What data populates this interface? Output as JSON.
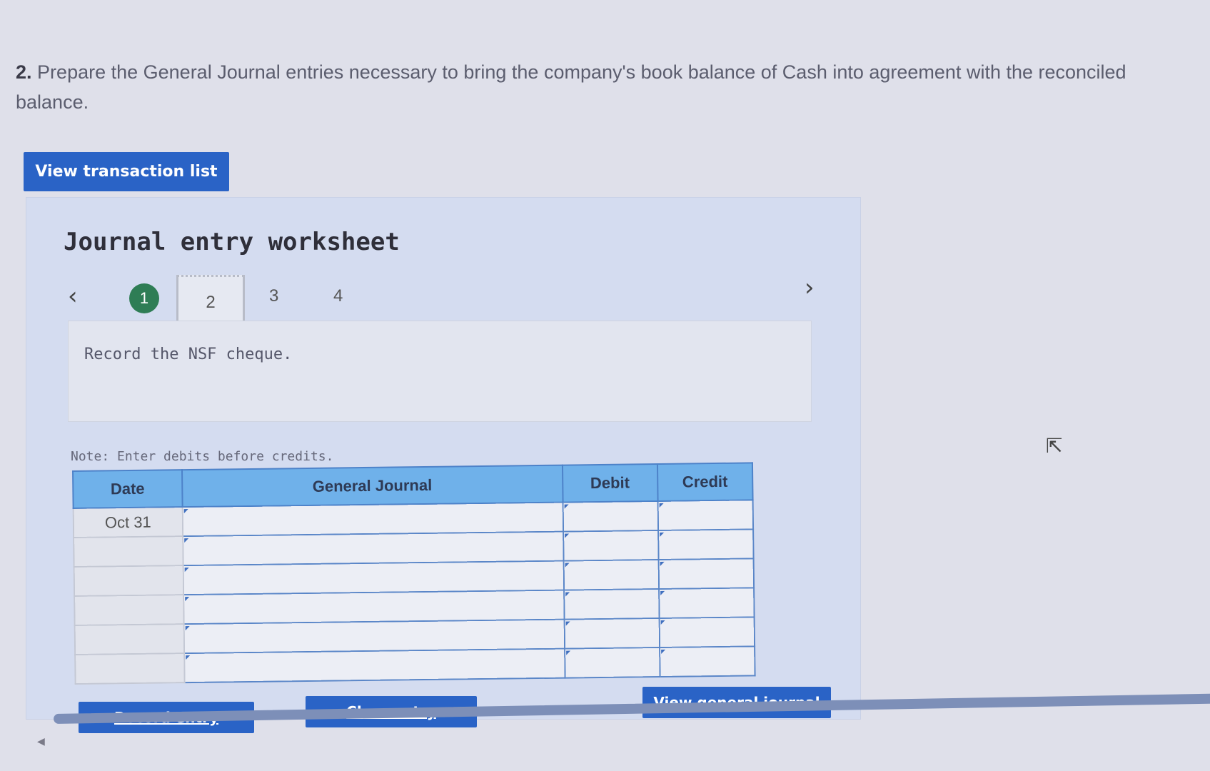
{
  "question": {
    "number": "2.",
    "text": "Prepare the General Journal entries necessary to bring the company's book balance of Cash into agreement with the reconciled balance."
  },
  "buttons": {
    "view_transaction_list": "View transaction list",
    "record_entry": "Record entry",
    "clear_entry": "Clear entry",
    "view_general_journal": "View general journal"
  },
  "worksheet": {
    "title": "Journal entry worksheet",
    "steps": {
      "done": "1",
      "current": "2",
      "s3": "3",
      "s4": "4"
    },
    "prev_icon": "chevron-left-icon",
    "next_icon": "chevron-right-icon",
    "description": "Record the NSF cheque.",
    "note": "Note: Enter debits before credits."
  },
  "table": {
    "headers": {
      "date": "Date",
      "journal": "General Journal",
      "debit": "Debit",
      "credit": "Credit"
    },
    "rows": [
      {
        "date": "Oct 31",
        "journal": "",
        "debit": "",
        "credit": ""
      },
      {
        "date": "",
        "journal": "",
        "debit": "",
        "credit": ""
      },
      {
        "date": "",
        "journal": "",
        "debit": "",
        "credit": ""
      },
      {
        "date": "",
        "journal": "",
        "debit": "",
        "credit": ""
      },
      {
        "date": "",
        "journal": "",
        "debit": "",
        "credit": ""
      },
      {
        "date": "",
        "journal": "",
        "debit": "",
        "credit": ""
      }
    ]
  },
  "colors": {
    "accent": "#2a63c6",
    "header": "#6fb1ea",
    "done_step": "#2e7d55"
  }
}
